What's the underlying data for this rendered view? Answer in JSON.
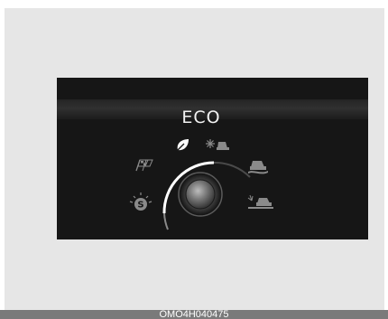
{
  "display": {
    "mode_title": "ECO",
    "selected_mode": "eco",
    "modes": [
      {
        "name": "eco",
        "icon": "leaf-icon",
        "active": true
      },
      {
        "name": "snow",
        "icon": "snowflake-car-icon",
        "active": false
      },
      {
        "name": "sport",
        "icon": "checkered-flag-icon",
        "active": false
      },
      {
        "name": "mud",
        "icon": "mud-car-icon",
        "active": false
      },
      {
        "name": "smart",
        "icon": "smart-s-icon",
        "active": false
      },
      {
        "name": "sand",
        "icon": "sand-car-icon",
        "active": false
      }
    ],
    "colors": {
      "active": "#ffffff",
      "inactive": "#8a8a8a",
      "panel": "#161616"
    }
  },
  "caption": {
    "code": "OMO4H040475"
  }
}
